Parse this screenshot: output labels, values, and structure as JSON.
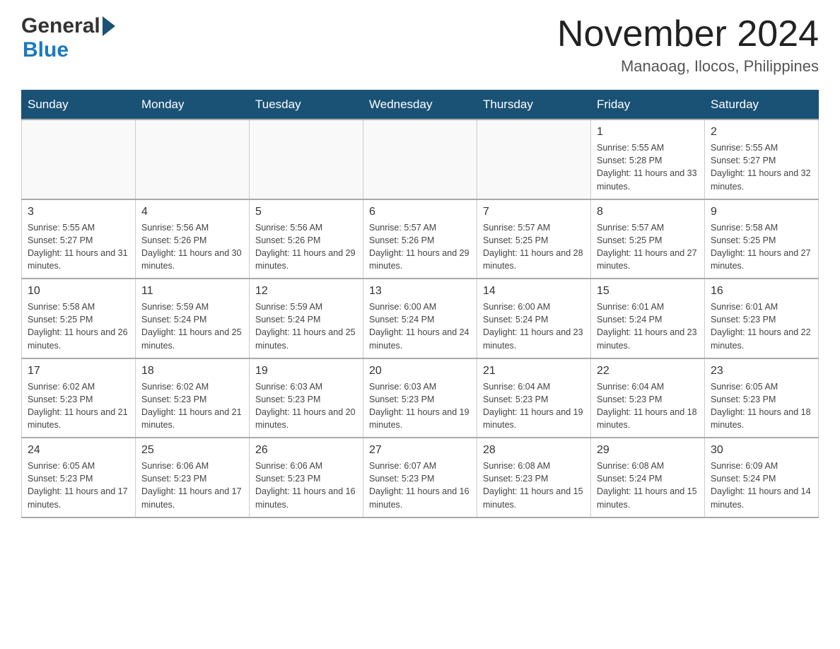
{
  "header": {
    "logo_general": "General",
    "logo_blue": "Blue",
    "month_title": "November 2024",
    "location": "Manaoag, Ilocos, Philippines"
  },
  "days_of_week": [
    "Sunday",
    "Monday",
    "Tuesday",
    "Wednesday",
    "Thursday",
    "Friday",
    "Saturday"
  ],
  "weeks": [
    [
      {
        "day": "",
        "info": ""
      },
      {
        "day": "",
        "info": ""
      },
      {
        "day": "",
        "info": ""
      },
      {
        "day": "",
        "info": ""
      },
      {
        "day": "",
        "info": ""
      },
      {
        "day": "1",
        "info": "Sunrise: 5:55 AM\nSunset: 5:28 PM\nDaylight: 11 hours and 33 minutes."
      },
      {
        "day": "2",
        "info": "Sunrise: 5:55 AM\nSunset: 5:27 PM\nDaylight: 11 hours and 32 minutes."
      }
    ],
    [
      {
        "day": "3",
        "info": "Sunrise: 5:55 AM\nSunset: 5:27 PM\nDaylight: 11 hours and 31 minutes."
      },
      {
        "day": "4",
        "info": "Sunrise: 5:56 AM\nSunset: 5:26 PM\nDaylight: 11 hours and 30 minutes."
      },
      {
        "day": "5",
        "info": "Sunrise: 5:56 AM\nSunset: 5:26 PM\nDaylight: 11 hours and 29 minutes."
      },
      {
        "day": "6",
        "info": "Sunrise: 5:57 AM\nSunset: 5:26 PM\nDaylight: 11 hours and 29 minutes."
      },
      {
        "day": "7",
        "info": "Sunrise: 5:57 AM\nSunset: 5:25 PM\nDaylight: 11 hours and 28 minutes."
      },
      {
        "day": "8",
        "info": "Sunrise: 5:57 AM\nSunset: 5:25 PM\nDaylight: 11 hours and 27 minutes."
      },
      {
        "day": "9",
        "info": "Sunrise: 5:58 AM\nSunset: 5:25 PM\nDaylight: 11 hours and 27 minutes."
      }
    ],
    [
      {
        "day": "10",
        "info": "Sunrise: 5:58 AM\nSunset: 5:25 PM\nDaylight: 11 hours and 26 minutes."
      },
      {
        "day": "11",
        "info": "Sunrise: 5:59 AM\nSunset: 5:24 PM\nDaylight: 11 hours and 25 minutes."
      },
      {
        "day": "12",
        "info": "Sunrise: 5:59 AM\nSunset: 5:24 PM\nDaylight: 11 hours and 25 minutes."
      },
      {
        "day": "13",
        "info": "Sunrise: 6:00 AM\nSunset: 5:24 PM\nDaylight: 11 hours and 24 minutes."
      },
      {
        "day": "14",
        "info": "Sunrise: 6:00 AM\nSunset: 5:24 PM\nDaylight: 11 hours and 23 minutes."
      },
      {
        "day": "15",
        "info": "Sunrise: 6:01 AM\nSunset: 5:24 PM\nDaylight: 11 hours and 23 minutes."
      },
      {
        "day": "16",
        "info": "Sunrise: 6:01 AM\nSunset: 5:23 PM\nDaylight: 11 hours and 22 minutes."
      }
    ],
    [
      {
        "day": "17",
        "info": "Sunrise: 6:02 AM\nSunset: 5:23 PM\nDaylight: 11 hours and 21 minutes."
      },
      {
        "day": "18",
        "info": "Sunrise: 6:02 AM\nSunset: 5:23 PM\nDaylight: 11 hours and 21 minutes."
      },
      {
        "day": "19",
        "info": "Sunrise: 6:03 AM\nSunset: 5:23 PM\nDaylight: 11 hours and 20 minutes."
      },
      {
        "day": "20",
        "info": "Sunrise: 6:03 AM\nSunset: 5:23 PM\nDaylight: 11 hours and 19 minutes."
      },
      {
        "day": "21",
        "info": "Sunrise: 6:04 AM\nSunset: 5:23 PM\nDaylight: 11 hours and 19 minutes."
      },
      {
        "day": "22",
        "info": "Sunrise: 6:04 AM\nSunset: 5:23 PM\nDaylight: 11 hours and 18 minutes."
      },
      {
        "day": "23",
        "info": "Sunrise: 6:05 AM\nSunset: 5:23 PM\nDaylight: 11 hours and 18 minutes."
      }
    ],
    [
      {
        "day": "24",
        "info": "Sunrise: 6:05 AM\nSunset: 5:23 PM\nDaylight: 11 hours and 17 minutes."
      },
      {
        "day": "25",
        "info": "Sunrise: 6:06 AM\nSunset: 5:23 PM\nDaylight: 11 hours and 17 minutes."
      },
      {
        "day": "26",
        "info": "Sunrise: 6:06 AM\nSunset: 5:23 PM\nDaylight: 11 hours and 16 minutes."
      },
      {
        "day": "27",
        "info": "Sunrise: 6:07 AM\nSunset: 5:23 PM\nDaylight: 11 hours and 16 minutes."
      },
      {
        "day": "28",
        "info": "Sunrise: 6:08 AM\nSunset: 5:23 PM\nDaylight: 11 hours and 15 minutes."
      },
      {
        "day": "29",
        "info": "Sunrise: 6:08 AM\nSunset: 5:24 PM\nDaylight: 11 hours and 15 minutes."
      },
      {
        "day": "30",
        "info": "Sunrise: 6:09 AM\nSunset: 5:24 PM\nDaylight: 11 hours and 14 minutes."
      }
    ]
  ]
}
